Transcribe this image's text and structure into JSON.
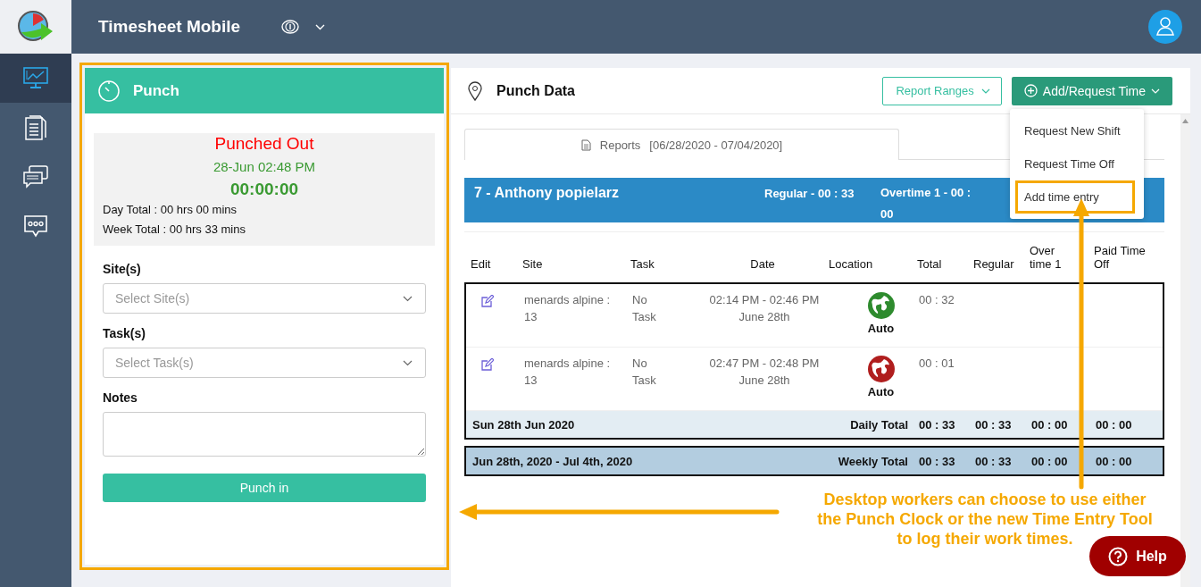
{
  "app": {
    "title": "Timesheet Mobile"
  },
  "sidebar": {
    "items": [
      {
        "kind": "dashboard",
        "selected": true
      },
      {
        "kind": "document",
        "selected": false
      },
      {
        "kind": "messages",
        "selected": false
      },
      {
        "kind": "chat",
        "selected": false
      }
    ]
  },
  "punch": {
    "title": "Punch",
    "status": "Punched Out",
    "time": "28-Jun 02:48 PM",
    "timer": "00:00:00",
    "day_total": "Day Total : 00 hrs 00 mins",
    "week_total": "Week Total : 00 hrs 33 mins",
    "fields": [
      {
        "kind": "select",
        "label": "Site(s)",
        "placeholder": "Select Site(s)"
      },
      {
        "kind": "select",
        "label": "Task(s)",
        "placeholder": "Select Task(s)"
      },
      {
        "kind": "textarea",
        "label": "Notes"
      }
    ],
    "button": "Punch in"
  },
  "punch_data": {
    "title": "Punch Data",
    "report_ranges": "Report Ranges",
    "add_button": "Add/Request Time",
    "menu": [
      {
        "label": "Request New Shift",
        "highlighted": false
      },
      {
        "label": "Request Time Off",
        "highlighted": false
      },
      {
        "label": "Add time entry",
        "highlighted": true
      }
    ],
    "tab": {
      "label": "Reports",
      "range": "[06/28/2020 - 07/04/2020]",
      "selected": true
    },
    "employee": {
      "name": "7 - Anthony popielarz",
      "regular": "Regular - 00 : 33",
      "overtime": "Overtime 1 - 00 : 00"
    },
    "table": {
      "columns": [
        "Edit",
        "Site",
        "Task",
        "Date",
        "Location",
        "Total",
        "Regular",
        "Over time 1",
        "Paid Time Off"
      ],
      "rows": [
        {
          "site": "menards alpine : 13",
          "task": "No Task",
          "time": "02:14 PM - 02:46 PM",
          "date": "June 28th",
          "location": "Auto",
          "color": "#2e8b2e",
          "total": "00 : 32"
        },
        {
          "site": "menards alpine : 13",
          "task": "No Task",
          "time": "02:47 PM - 02:48 PM",
          "date": "June 28th",
          "location": "Auto",
          "color": "#b01e1e",
          "total": "00 : 01"
        }
      ],
      "daily": {
        "label": "Sun 28th Jun 2020",
        "title": "Daily Total",
        "values": [
          "00 : 33",
          "00 : 33",
          "00 : 00",
          "00 : 00"
        ]
      },
      "weekly": {
        "label": "Jun 28th, 2020  -  Jul 4th, 2020",
        "title": "Weekly Total",
        "values": [
          "00 : 33",
          "00 : 33",
          "00 : 00",
          "00 : 00"
        ]
      }
    }
  },
  "callout": {
    "lines": [
      "Desktop workers can choose to use either",
      "the Punch Clock or the new  Time Entry Tool",
      "to log their work times."
    ]
  },
  "help": {
    "label": "Help"
  }
}
